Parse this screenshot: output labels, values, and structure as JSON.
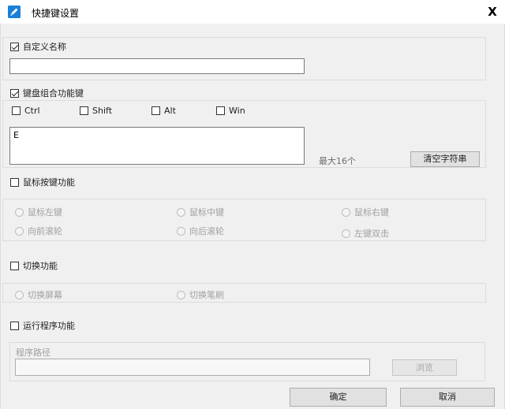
{
  "window": {
    "title": "快捷键设置",
    "close_label": "X"
  },
  "custom_name": {
    "label": "自定义名称",
    "checked": true,
    "value": ""
  },
  "keyboard": {
    "label": "键盘组合功能键",
    "checked": true,
    "modifiers": [
      {
        "label": "Ctrl",
        "checked": false
      },
      {
        "label": "Shift",
        "checked": false
      },
      {
        "label": "Alt",
        "checked": false
      },
      {
        "label": "Win",
        "checked": false
      }
    ],
    "keys_value": "E",
    "max_hint": "最大16个",
    "clear_label": "清空字符串"
  },
  "mouse": {
    "label": "鼠标按键功能",
    "checked": false,
    "options": [
      "鼠标左键",
      "鼠标中键",
      "鼠标右键",
      "向前滚轮",
      "向后滚轮",
      "左键双击"
    ]
  },
  "switch": {
    "label": "切换功能",
    "checked": false,
    "options": [
      "切换屏幕",
      "切换笔刷"
    ]
  },
  "run_program": {
    "label": "运行程序功能",
    "checked": false,
    "path_label": "程序路径",
    "path_value": "",
    "browse_label": "浏览"
  },
  "footer": {
    "ok_label": "确定",
    "cancel_label": "取消"
  },
  "colors": {
    "accent": "#1a7fd8",
    "panel": "#f0f0f0",
    "border": "#dcdcdc"
  }
}
